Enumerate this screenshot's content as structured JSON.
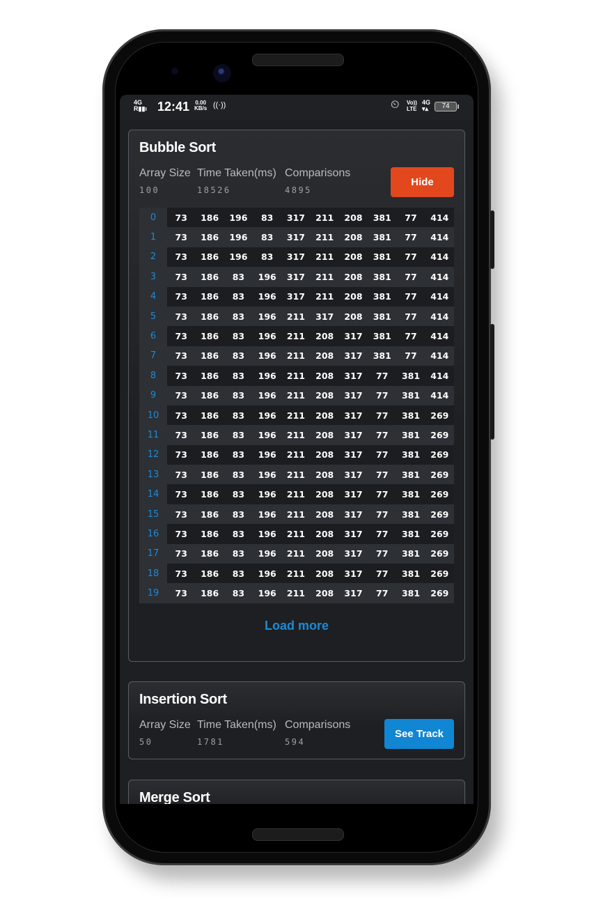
{
  "status_bar": {
    "signal": "4G",
    "time": "12:41",
    "speed_value": "0.00",
    "speed_unit": "KB/s",
    "volte_top": "Vo))",
    "volte_bottom": "LTE",
    "network": "4G",
    "battery": "74"
  },
  "bubble_sort": {
    "title": "Bubble Sort",
    "labels": {
      "array_size": "Array Size",
      "time_taken": "Time Taken(ms)",
      "comparisons": "Comparisons"
    },
    "array_size": "100",
    "time_taken": "18526",
    "comparisons": "4895",
    "button": "Hide",
    "rows": [
      {
        "index": "0",
        "values": [
          "73",
          "186",
          "196",
          "83",
          "317",
          "211",
          "208",
          "381",
          "77",
          "414"
        ]
      },
      {
        "index": "1",
        "values": [
          "73",
          "186",
          "196",
          "83",
          "317",
          "211",
          "208",
          "381",
          "77",
          "414"
        ]
      },
      {
        "index": "2",
        "values": [
          "73",
          "186",
          "196",
          "83",
          "317",
          "211",
          "208",
          "381",
          "77",
          "414"
        ]
      },
      {
        "index": "3",
        "values": [
          "73",
          "186",
          "83",
          "196",
          "317",
          "211",
          "208",
          "381",
          "77",
          "414"
        ]
      },
      {
        "index": "4",
        "values": [
          "73",
          "186",
          "83",
          "196",
          "317",
          "211",
          "208",
          "381",
          "77",
          "414"
        ]
      },
      {
        "index": "5",
        "values": [
          "73",
          "186",
          "83",
          "196",
          "211",
          "317",
          "208",
          "381",
          "77",
          "414"
        ]
      },
      {
        "index": "6",
        "values": [
          "73",
          "186",
          "83",
          "196",
          "211",
          "208",
          "317",
          "381",
          "77",
          "414"
        ]
      },
      {
        "index": "7",
        "values": [
          "73",
          "186",
          "83",
          "196",
          "211",
          "208",
          "317",
          "381",
          "77",
          "414"
        ]
      },
      {
        "index": "8",
        "values": [
          "73",
          "186",
          "83",
          "196",
          "211",
          "208",
          "317",
          "77",
          "381",
          "414"
        ]
      },
      {
        "index": "9",
        "values": [
          "73",
          "186",
          "83",
          "196",
          "211",
          "208",
          "317",
          "77",
          "381",
          "414"
        ]
      },
      {
        "index": "10",
        "values": [
          "73",
          "186",
          "83",
          "196",
          "211",
          "208",
          "317",
          "77",
          "381",
          "269"
        ]
      },
      {
        "index": "11",
        "values": [
          "73",
          "186",
          "83",
          "196",
          "211",
          "208",
          "317",
          "77",
          "381",
          "269"
        ]
      },
      {
        "index": "12",
        "values": [
          "73",
          "186",
          "83",
          "196",
          "211",
          "208",
          "317",
          "77",
          "381",
          "269"
        ]
      },
      {
        "index": "13",
        "values": [
          "73",
          "186",
          "83",
          "196",
          "211",
          "208",
          "317",
          "77",
          "381",
          "269"
        ]
      },
      {
        "index": "14",
        "values": [
          "73",
          "186",
          "83",
          "196",
          "211",
          "208",
          "317",
          "77",
          "381",
          "269"
        ]
      },
      {
        "index": "15",
        "values": [
          "73",
          "186",
          "83",
          "196",
          "211",
          "208",
          "317",
          "77",
          "381",
          "269"
        ]
      },
      {
        "index": "16",
        "values": [
          "73",
          "186",
          "83",
          "196",
          "211",
          "208",
          "317",
          "77",
          "381",
          "269"
        ]
      },
      {
        "index": "17",
        "values": [
          "73",
          "186",
          "83",
          "196",
          "211",
          "208",
          "317",
          "77",
          "381",
          "269"
        ]
      },
      {
        "index": "18",
        "values": [
          "73",
          "186",
          "83",
          "196",
          "211",
          "208",
          "317",
          "77",
          "381",
          "269"
        ]
      },
      {
        "index": "19",
        "values": [
          "73",
          "186",
          "83",
          "196",
          "211",
          "208",
          "317",
          "77",
          "381",
          "269"
        ]
      }
    ],
    "load_more": "Load more"
  },
  "insertion_sort": {
    "title": "Insertion Sort",
    "labels": {
      "array_size": "Array Size",
      "time_taken": "Time Taken(ms)",
      "comparisons": "Comparisons"
    },
    "array_size": "50",
    "time_taken": "1781",
    "comparisons": "594",
    "button": "See Track"
  },
  "merge_sort": {
    "title": "Merge Sort"
  },
  "colors": {
    "accent_blue": "#1e8ad6",
    "hide_button": "#e2471d",
    "track_button": "#1186d3"
  }
}
